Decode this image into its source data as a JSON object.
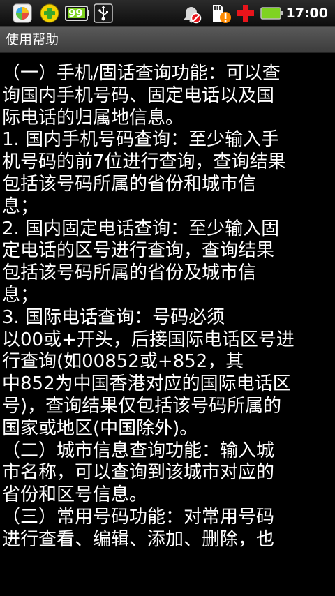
{
  "status_bar": {
    "icons": [
      "app-store-icon",
      "plus-app-icon",
      "battery-99-icon",
      "usb-icon",
      "alarm-off-icon",
      "sd-card-warning-icon",
      "red-cross-icon",
      "battery-icon"
    ],
    "battery_badge": "99",
    "time": "17:00",
    "colors": {
      "battery_green": "#7fd321",
      "warning_orange": "#ff8a00",
      "cross_red": "#e8141b"
    }
  },
  "title_bar": {
    "title": "使用帮助"
  },
  "help": {
    "lines": [
      "（一）手机/固话查询功能：可以查",
      "询国内手机号码、固定电话以及国",
      "际电话的归属地信息。",
      "1. 国内手机号码查询：至少输入手",
      "机号码的前7位进行查询，查询结果",
      "包括该号码所属的省份和城市信",
      "息；",
      "2. 国内固定电话查询：至少输入固",
      "定电话的区号进行查询，查询结果",
      "包括该号码所属的省份及城市信",
      "息；",
      "3. 国际电话查询：号码必须",
      "以00或+开头，后接国际电话区号进",
      "行查询(如00852或+852，其",
      "中852为中国香港对应的国际电话区",
      "号)，查询结果仅包括该号码所属的",
      "国家或地区(中国除外)。",
      "（二）城市信息查询功能：输入城",
      "市名称，可以查询到该城市对应的",
      "省份和区号信息。",
      "（三）常用号码功能：对常用号码",
      "进行查看、编辑、添加、删除，也"
    ]
  }
}
